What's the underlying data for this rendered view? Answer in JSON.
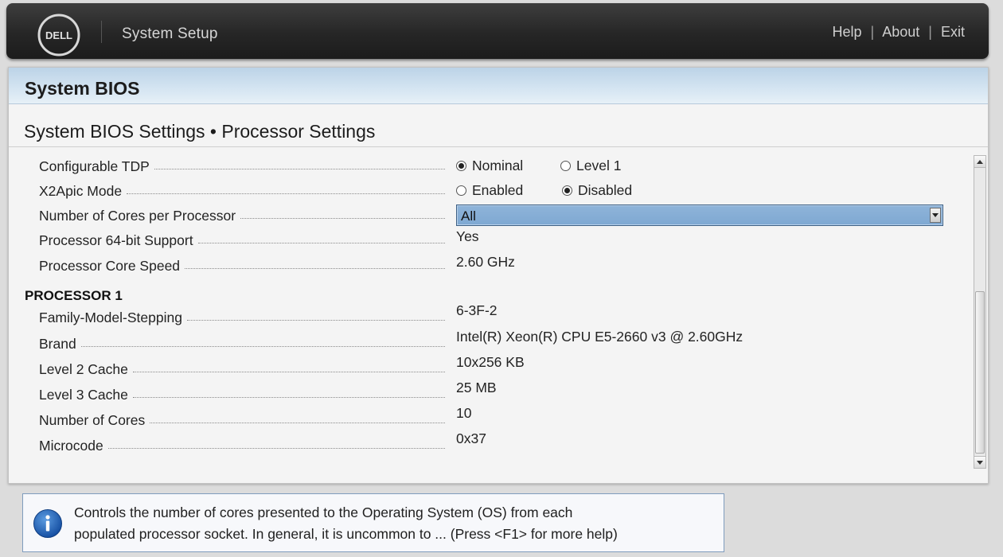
{
  "header": {
    "logo_text": "DELL",
    "app_title": "System Setup",
    "links": [
      "Help",
      "About",
      "Exit"
    ],
    "separator": "|"
  },
  "panel": {
    "title": "System BIOS",
    "subtitle": "System BIOS Settings • Processor Settings"
  },
  "settings": {
    "configurable_tdp": {
      "label": "Configurable TDP",
      "options": [
        "Nominal",
        "Level 1"
      ],
      "selected": "Nominal"
    },
    "x2apic_mode": {
      "label": "X2Apic Mode",
      "options": [
        "Enabled",
        "Disabled"
      ],
      "selected": "Disabled"
    },
    "cores_per_processor": {
      "label": "Number of Cores per Processor",
      "value": "All"
    },
    "processor_64bit": {
      "label": "Processor 64-bit Support",
      "value": "Yes"
    },
    "core_speed": {
      "label": "Processor Core Speed",
      "value": "2.60 GHz"
    }
  },
  "processor1": {
    "heading": "PROCESSOR 1",
    "rows": [
      {
        "label": "Family-Model-Stepping",
        "value": "6-3F-2"
      },
      {
        "label": "Brand",
        "value": "Intel(R) Xeon(R) CPU E5-2660 v3 @ 2.60GHz"
      },
      {
        "label": "Level 2 Cache",
        "value": "10x256 KB"
      },
      {
        "label": "Level 3 Cache",
        "value": "25 MB"
      },
      {
        "label": "Number of Cores",
        "value": "10"
      },
      {
        "label": "Microcode",
        "value": "0x37"
      }
    ]
  },
  "help": {
    "icon": "info-icon",
    "line1": "Controls the number of cores presented to the Operating System (OS) from each",
    "line2": "populated processor socket. In general, it is uncommon to ... (Press <F1> for more help)"
  },
  "colors": {
    "header_bg": "#262626",
    "panel_header_bg": "#c9dceb",
    "dropdown_bg": "#85acd5",
    "info_icon": "#1e63b8"
  }
}
